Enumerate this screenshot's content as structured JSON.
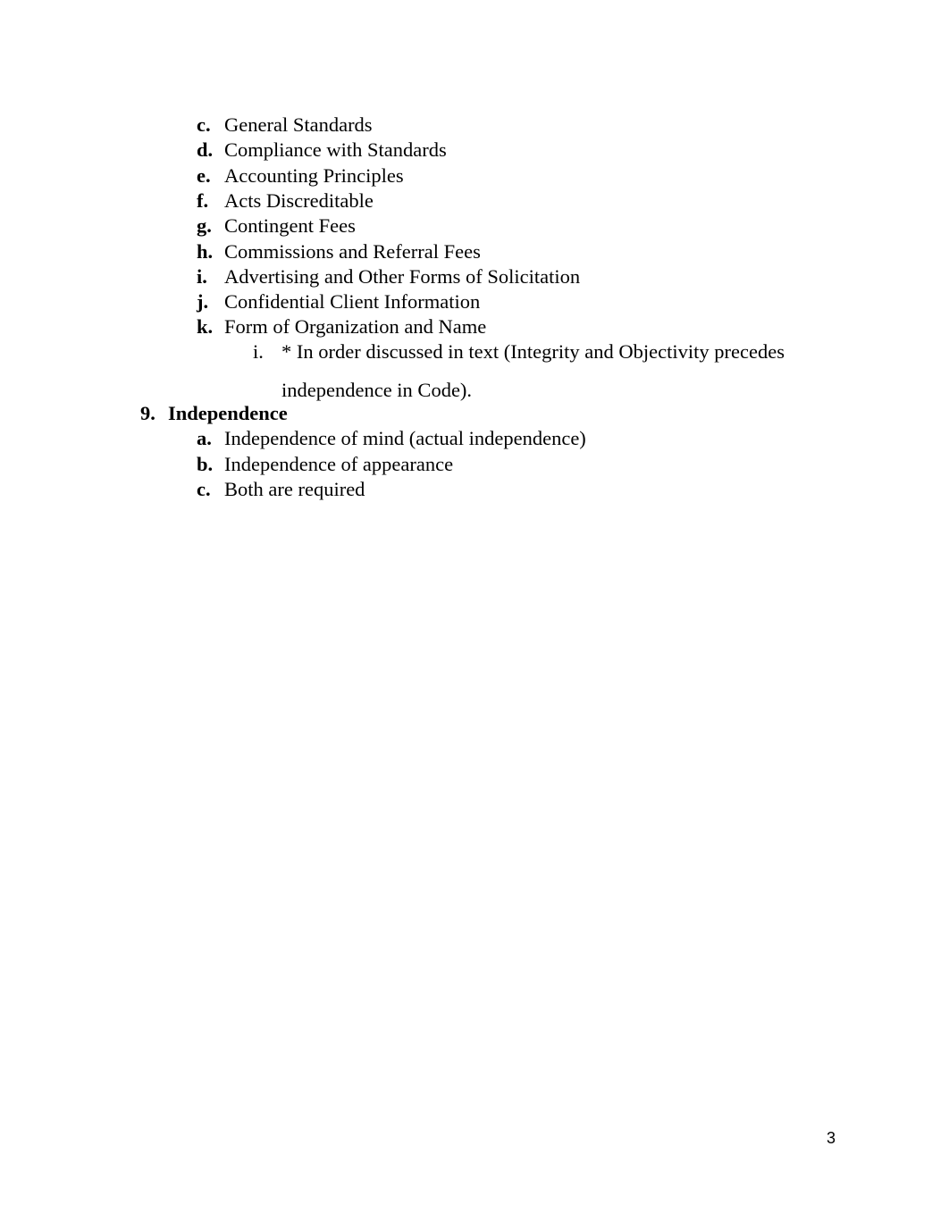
{
  "document": {
    "page_number": "3",
    "background_color": "#ffffff",
    "text_color": "#000000"
  },
  "outline": {
    "continued_list": {
      "items": [
        {
          "marker": "c.",
          "text": "General Standards"
        },
        {
          "marker": "d.",
          "text": "Compliance with Standards"
        },
        {
          "marker": "e.",
          "text": "Accounting Principles"
        },
        {
          "marker": "f.",
          "text": "Acts Discreditable"
        },
        {
          "marker": "g.",
          "text": "Contingent Fees"
        },
        {
          "marker": "h.",
          "text": "Commissions and Referral Fees"
        },
        {
          "marker": "i.",
          "text": "Advertising and Other Forms of Solicitation"
        },
        {
          "marker": "j.",
          "text": "Confidential Client Information"
        },
        {
          "marker": "k.",
          "text": "Form of Organization and Name"
        }
      ],
      "sub_note": {
        "marker": "i.",
        "line1": "* In order discussed in text (Integrity and Objectivity precedes",
        "line2": "independence in Code)."
      }
    },
    "section_9": {
      "marker": "9.",
      "heading": "Independence",
      "items": [
        {
          "marker": "a.",
          "text": "Independence of mind (actual independence)"
        },
        {
          "marker": "b.",
          "text": "Independence of appearance"
        },
        {
          "marker": "c.",
          "text": "Both are required"
        }
      ]
    }
  }
}
